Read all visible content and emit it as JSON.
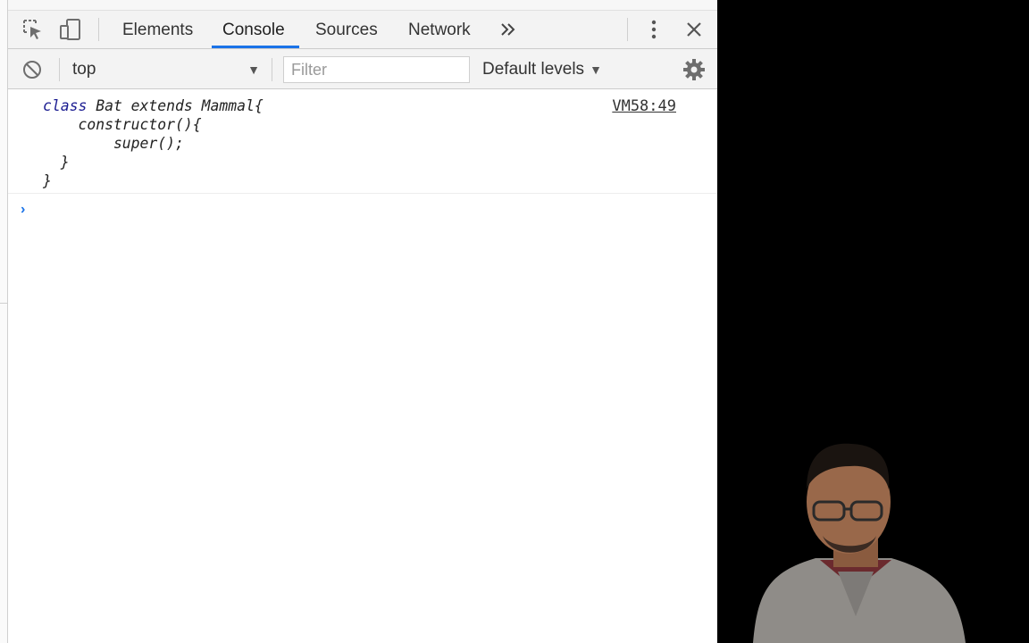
{
  "devtools": {
    "tabs": [
      {
        "label": "Elements"
      },
      {
        "label": "Console",
        "active": true
      },
      {
        "label": "Sources"
      },
      {
        "label": "Network"
      }
    ],
    "overflow_icon": "double-chevron-right-icon",
    "toolbar_icons": [
      "inspect-element-icon",
      "device-toolbar-icon",
      "kebab-menu-icon",
      "close-icon"
    ]
  },
  "console_toolbar": {
    "clear_icon": "clear-console-icon",
    "context": "top",
    "filter_placeholder": "Filter",
    "levels": "Default levels",
    "settings_icon": "gear-icon"
  },
  "console": {
    "messages": [
      {
        "lines": [
          {
            "keyword": "class",
            "rest": " Bat extends Mammal{"
          },
          {
            "keyword": "",
            "rest": "    constructor(){"
          },
          {
            "keyword": "",
            "rest": "        super();"
          },
          {
            "keyword": "",
            "rest": "  }"
          },
          {
            "keyword": "",
            "rest": "}"
          }
        ],
        "source": "VM58:49"
      }
    ],
    "prompt_symbol": "›"
  },
  "colors": {
    "accent": "#1a73e8",
    "keyword": "#1b1c91"
  }
}
